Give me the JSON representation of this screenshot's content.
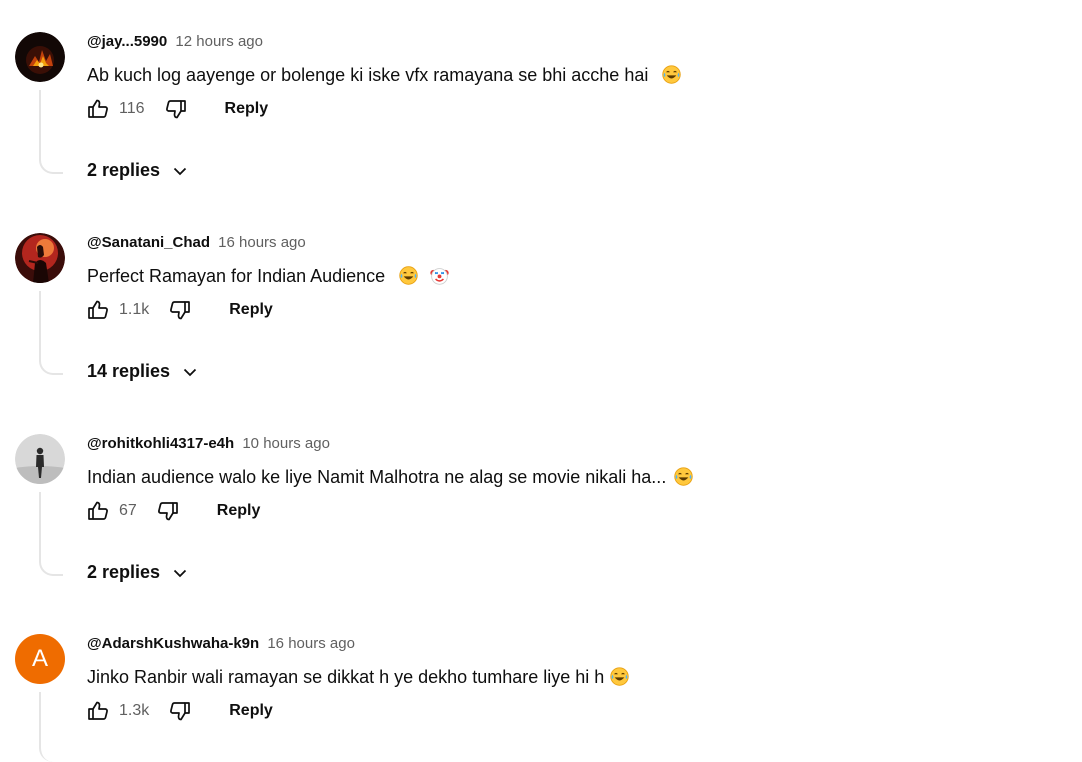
{
  "comments": [
    {
      "handle": "@jay...5990",
      "time": "12 hours ago",
      "text": "Ab kuch log aayenge or bolenge ki iske vfx ramayana se bhi acche hai",
      "emojis": [
        "laughing-tears"
      ],
      "likes": "116",
      "reply_label": "Reply",
      "replies_label": "2 replies"
    },
    {
      "handle": "@Sanatani_Chad",
      "time": "16 hours ago",
      "text": "Perfect Ramayan for Indian Audience",
      "emojis": [
        "laughing-tears",
        "clown"
      ],
      "likes": "1.1k",
      "reply_label": "Reply",
      "replies_label": "14 replies"
    },
    {
      "handle": "@rohitkohli4317-e4h",
      "time": "10 hours ago",
      "text": "Indian audience walo ke liye Namit Malhotra ne alag se movie nikali ha...",
      "emojis": [
        "laughing-tears"
      ],
      "likes": "67",
      "reply_label": "Reply",
      "replies_label": "2 replies"
    },
    {
      "handle": "@AdarshKushwaha-k9n",
      "time": "16 hours ago",
      "text": "Jinko Ranbir wali ramayan se dikkat h ye dekho tumhare liye hi h",
      "emojis": [
        "laughing-tears"
      ],
      "likes": "1.3k",
      "reply_label": "Reply",
      "avatar_letter": "A",
      "avatar_color": "#ef6c00"
    }
  ],
  "icons": {
    "like": "thumbs-up-icon",
    "dislike": "thumbs-down-icon",
    "expand": "chevron-down-icon"
  }
}
